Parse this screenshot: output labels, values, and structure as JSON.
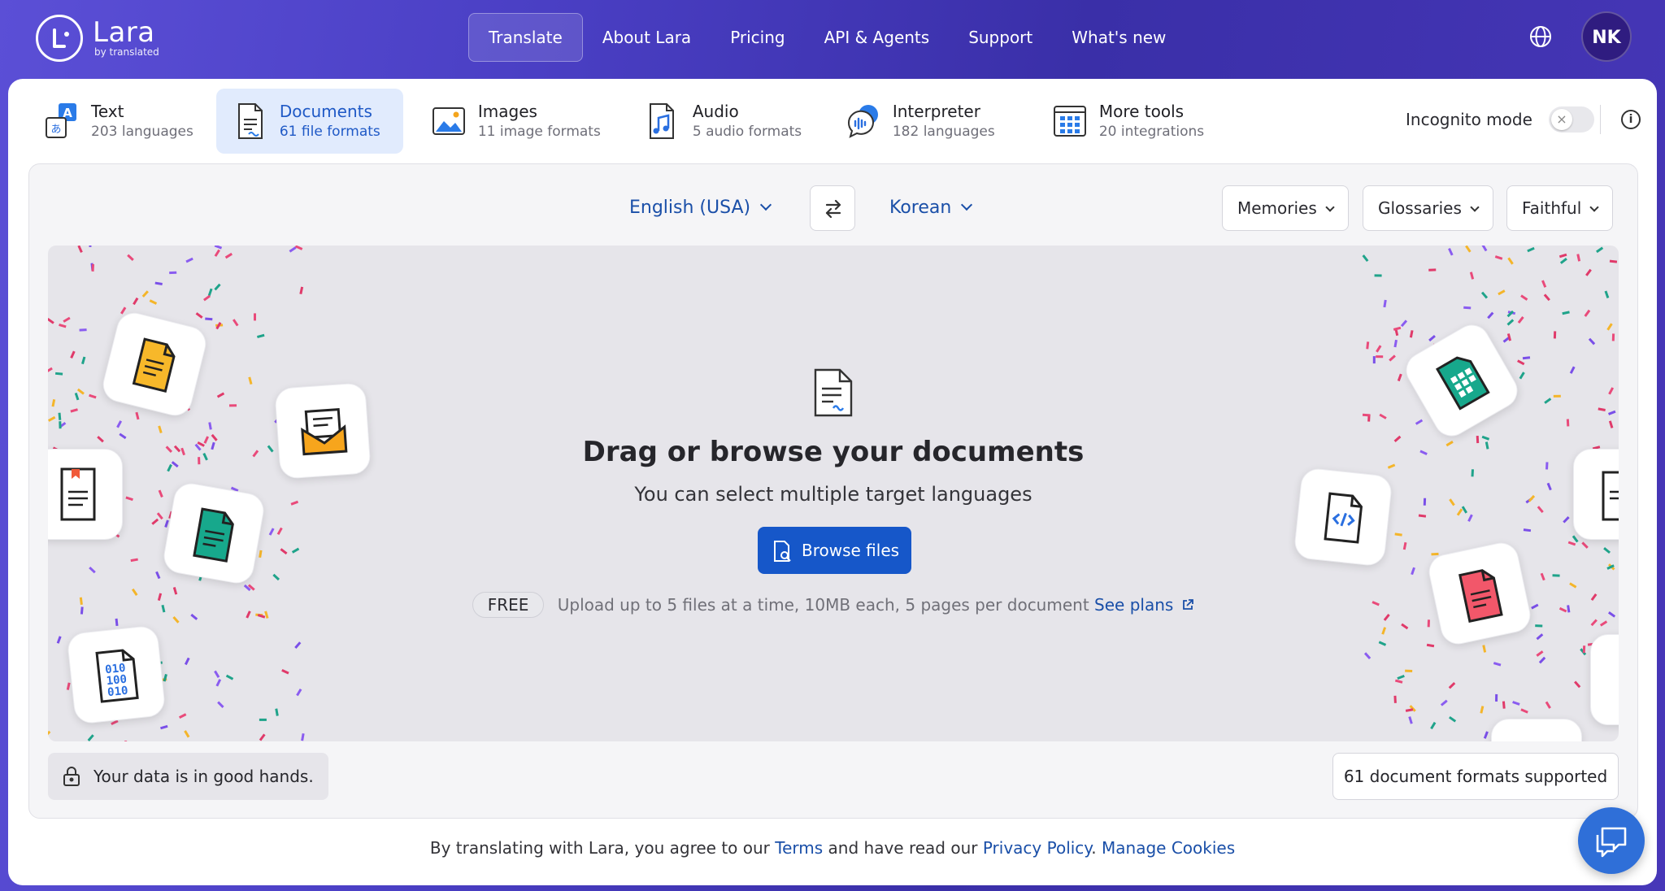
{
  "brand": {
    "name": "Lara",
    "tagline": "by translated"
  },
  "nav": {
    "items": [
      {
        "label": "Translate",
        "active": true
      },
      {
        "label": "About Lara"
      },
      {
        "label": "Pricing"
      },
      {
        "label": "API & Agents"
      },
      {
        "label": "Support"
      },
      {
        "label": "What's new"
      }
    ]
  },
  "user": {
    "initials": "NK"
  },
  "tabs": [
    {
      "title": "Text",
      "sub": "203 languages",
      "icon": "text-translate-icon"
    },
    {
      "title": "Documents",
      "sub": "61 file formats",
      "icon": "document-icon",
      "active": true
    },
    {
      "title": "Images",
      "sub": "11 image formats",
      "icon": "image-icon"
    },
    {
      "title": "Audio",
      "sub": "5 audio formats",
      "icon": "audio-icon"
    },
    {
      "title": "Interpreter",
      "sub": "182 languages",
      "icon": "interpreter-icon"
    },
    {
      "title": "More tools",
      "sub": "20 integrations",
      "icon": "grid-tools-icon"
    }
  ],
  "incognito": {
    "label": "Incognito mode",
    "enabled": false
  },
  "languages": {
    "source": "English (USA)",
    "target": "Korean"
  },
  "options": {
    "memories": "Memories",
    "glossaries": "Glossaries",
    "style": "Faithful"
  },
  "dropzone": {
    "title": "Drag or browse your documents",
    "subtitle": "You can select multiple target languages",
    "browse_label": "Browse files",
    "plan_badge": "FREE",
    "plan_text": "Upload up to 5 files at a time, 10MB each, 5 pages per document",
    "plans_link": "See plans"
  },
  "footer": {
    "data_safe": "Your data is in good hands.",
    "formats": "61 document formats supported",
    "terms_prefix": "By translating with Lara, you agree to our",
    "terms_link": "Terms",
    "terms_mid": "and have read our",
    "privacy_link": "Privacy Policy",
    "cookies_link": "Manage Cookies"
  },
  "colors": {
    "accent": "#1657c9",
    "link": "#1a4fa8",
    "active_tab_bg": "#e1ebfd"
  }
}
